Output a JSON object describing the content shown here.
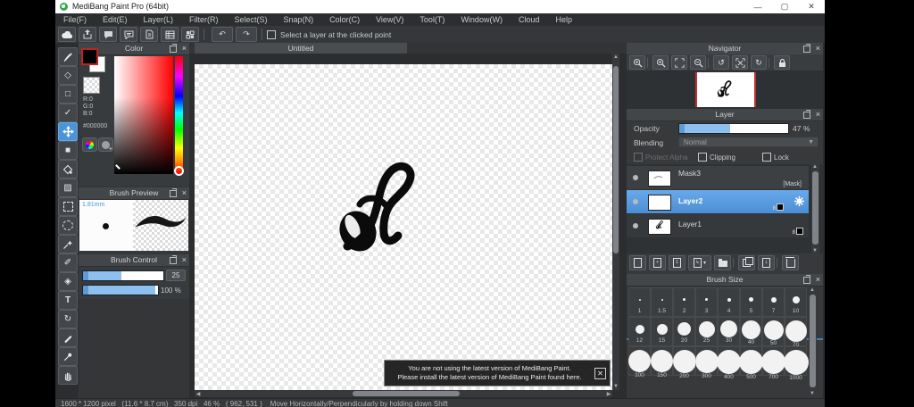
{
  "window": {
    "title": "MediBang Paint Pro (64bit)",
    "minimize": "—",
    "maximize": "▢",
    "close": "✕"
  },
  "menus": [
    "File(F)",
    "Edit(E)",
    "Layer(L)",
    "Filter(R)",
    "Select(S)",
    "Snap(N)",
    "Color(C)",
    "View(V)",
    "Tool(T)",
    "Window(W)",
    "Cloud",
    "Help"
  ],
  "toolbar": {
    "select_layer_label": "Select a layer at the clicked point"
  },
  "icons": {
    "top": [
      "cloud-icon",
      "export-icon",
      "comment-icon",
      "message-icon",
      "document-icon",
      "list-icon",
      "grid-icon",
      "undo-icon",
      "redo-icon"
    ],
    "tools": [
      "brush-tool",
      "eraser-tool",
      "dot-tool",
      "operation-tool",
      "move-tool",
      "fill-tool",
      "bucket-tool",
      "gradient-tool",
      "marquee-select-tool",
      "lasso-select-tool",
      "magic-wand-tool",
      "select-pen-tool",
      "select-eraser-tool",
      "text-tool",
      "rotate-tool",
      "divide-tool",
      "eyedropper-tool",
      "hand-tool"
    ],
    "navigator": [
      "zoom-in-icon",
      "zoom-in-icon",
      "fit-screen-icon",
      "zoom-out-icon",
      "rotate-left-icon",
      "reset-view-icon",
      "rotate-right-icon",
      "lock-icon"
    ],
    "layer_toolbar": [
      "new-layer-icon",
      "duplicate-layer-icon",
      "new-1bit-layer-icon",
      "add-layer-menu-icon",
      "folder-icon",
      "copy-layer-icon",
      "merge-layer-icon",
      "delete-layer-icon"
    ]
  },
  "color_panel": {
    "title": "Color",
    "r": "R:0",
    "g": "G:0",
    "b": "B:0",
    "hex": "#000000"
  },
  "brush_preview": {
    "title": "Brush Preview",
    "size_label": "1.81mm"
  },
  "brush_control": {
    "title": "Brush Control",
    "value1": "25",
    "value2": "100 %"
  },
  "canvas": {
    "tab": "Untitled"
  },
  "notification": {
    "line1": "You are not using the latest version of MediBang Paint.",
    "line2": "Please install the latest version of MediBang Paint found here.",
    "close": "✕"
  },
  "navigator": {
    "title": "Navigator"
  },
  "layer_panel": {
    "title": "Layer",
    "opacity_label": "Opacity",
    "opacity_value": "47 %",
    "blending_label": "Blending",
    "blending_value": "Normal",
    "protect_alpha_label": "Protect Alpha",
    "clipping_label": "Clipping",
    "lock_label": "Lock",
    "layers": [
      {
        "name": "Mask3",
        "badge": "[Mask]"
      },
      {
        "name": "Layer2",
        "bit": "8",
        "selected": true
      },
      {
        "name": "Layer1",
        "bit": "8"
      }
    ]
  },
  "brush_size": {
    "title": "Brush Size",
    "sizes": [
      "1",
      "1.5",
      "2",
      "3",
      "4",
      "5",
      "7",
      "10",
      "12",
      "15",
      "20",
      "25",
      "30",
      "40",
      "50",
      "70",
      "100",
      "150",
      "200",
      "300",
      "400",
      "500",
      "700",
      "1000"
    ]
  },
  "statusbar": {
    "text": "1600 * 1200 pixel   (11.6 * 8.7 cm)   350 dpi   46 %   ( 962, 531 )    Move Horizontally/Perpendicularly by holding down Shift"
  },
  "colors": {
    "accent_blue": "#4b94d8",
    "selection_blue": "#5b9fe0",
    "slider_fill": "#8ec0ef",
    "canvas_border_red": "#c03232",
    "fg_color": "#000000"
  }
}
